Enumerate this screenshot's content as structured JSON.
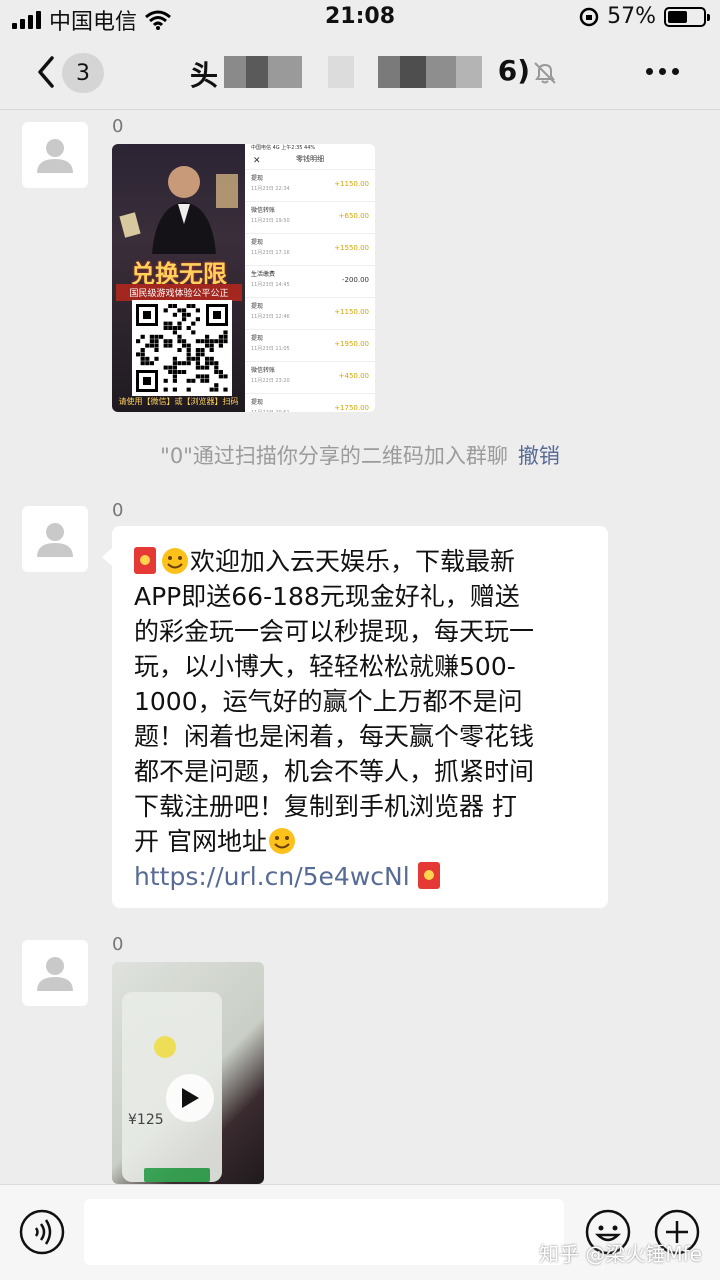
{
  "status_bar": {
    "carrier": "中国电信",
    "time": "21:08",
    "battery_percent": "57%",
    "battery_level": 0.57
  },
  "nav": {
    "unread_count": "3",
    "title_visible_start": "头",
    "title_visible_end": "6)"
  },
  "messages": {
    "msg1_sender": "0",
    "poster_title": "兑换无限制",
    "poster_subtitle": "国民级游戏体验公平公正",
    "poster_footer": "请使用【微信】或【浏览器】扫码",
    "shot_status": "中国电信 4G   上午2:35   44%",
    "shot_title": "零钱明细",
    "ledger": [
      {
        "name": "提现",
        "date": "11月23日 22:34",
        "amount": "+1150.00"
      },
      {
        "name": "微信转账",
        "date": "11月23日 19:50",
        "amount": "+650.00"
      },
      {
        "name": "提现",
        "date": "11月23日 17:16",
        "amount": "+1550.00"
      },
      {
        "name": "生活缴费",
        "date": "11月23日 14:45",
        "amount": "-200.00"
      },
      {
        "name": "提现",
        "date": "11月23日 12:46",
        "amount": "+1150.00"
      },
      {
        "name": "提现",
        "date": "11月23日 11:05",
        "amount": "+1950.00"
      },
      {
        "name": "微信转账",
        "date": "11月22日 23:20",
        "amount": "+450.00"
      },
      {
        "name": "提现",
        "date": "11月22日 20:51",
        "amount": "+1750.00"
      }
    ],
    "notice_text": "\"0\"通过扫描你分享的二维码加入群聊",
    "notice_action": "撤销",
    "msg2_sender": "0",
    "msg2_lines": [
      "欢迎加入云天娱乐，下载最新",
      "APP即送66-188元现金好礼，赠送",
      "的彩金玩一会可以秒提现，每天玩一",
      "玩，以小博大，轻轻松松就赚500-",
      "1000，运气好的赢个上万都不是问",
      "题！闲着也是闲着，每天赢个零花钱",
      "都不是问题，机会不等人，抓紧时间",
      "下载注册吧！复制到手机浏览器 打",
      "开  官网地址"
    ],
    "msg2_link": "https://url.cn/5e4wcNl",
    "msg3_sender": "0",
    "video_amount": "¥125"
  },
  "input_bar": {
    "placeholder": ""
  },
  "watermark": "知乎 @梁火锤Mfe",
  "colors": {
    "background": "#ededed",
    "bubble": "#ffffff",
    "link": "#576b95",
    "redpack": "#e53935"
  },
  "icons": [
    "back-icon",
    "mute-icon",
    "more-icon",
    "avatar-placeholder-icon",
    "play-icon",
    "voice-icon",
    "emoji-icon",
    "plus-icon"
  ]
}
